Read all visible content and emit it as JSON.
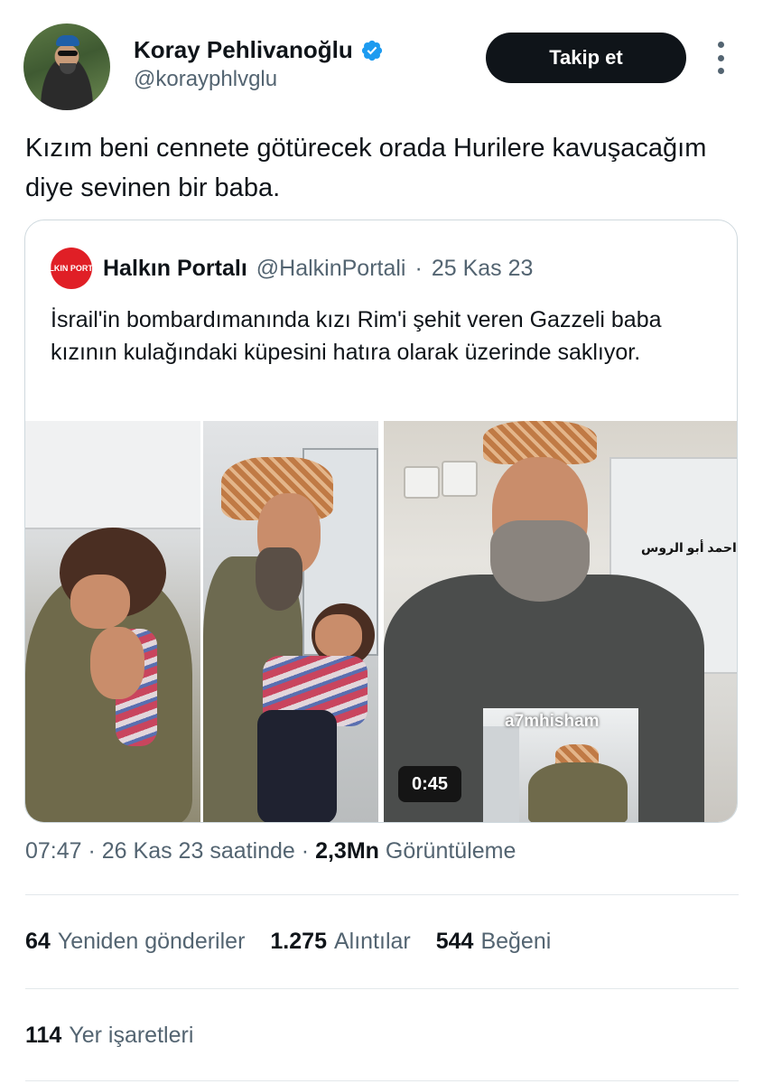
{
  "author": {
    "name": "Koray Pehlivanoğlu",
    "handle": "@korayphlvglu",
    "verified_color": "#1d9bf0"
  },
  "follow_button": {
    "label": "Takip et"
  },
  "more_button": {
    "icon": "more-vertical-icon"
  },
  "tweet": {
    "text": "Kızım beni cennete götürecek orada Hurilere kavuşacağım diye sevinen bir baba."
  },
  "quote": {
    "avatar_text": "HALKIN PORTALI",
    "name": "Halkın Portalı",
    "handle": "@HalkinPortali",
    "separator": "·",
    "date": "25 Kas 23",
    "text": "İsrail'in bombardımanında kızı Rim'i şehit veren Gazzeli baba kızının kulağındaki küpesini hatıra olarak üzerinde saklıyor.",
    "media": {
      "overlay_arabic": "احمد أبو الروس",
      "pip_label": "a7mhisham",
      "duration": "0:45"
    }
  },
  "meta": {
    "time": "07:47",
    "sep1": " · ",
    "date_text": "26 Kas 23 saatinde",
    "sep2": " · ",
    "views": "2,3Mn",
    "views_label": "Görüntüleme"
  },
  "stats": {
    "reposts": {
      "count": "64",
      "label": "Yeniden gönderiler"
    },
    "quotes": {
      "count": "1.275",
      "label": "Alıntılar"
    },
    "likes": {
      "count": "544",
      "label": "Beğeni"
    },
    "bookmarks": {
      "count": "114",
      "label": "Yer işaretleri"
    }
  },
  "colors": {
    "text_primary": "#0f1419",
    "text_secondary": "#536471",
    "border": "#cfd9de",
    "button_bg": "#0f1419",
    "brand_red": "#e01f26"
  }
}
